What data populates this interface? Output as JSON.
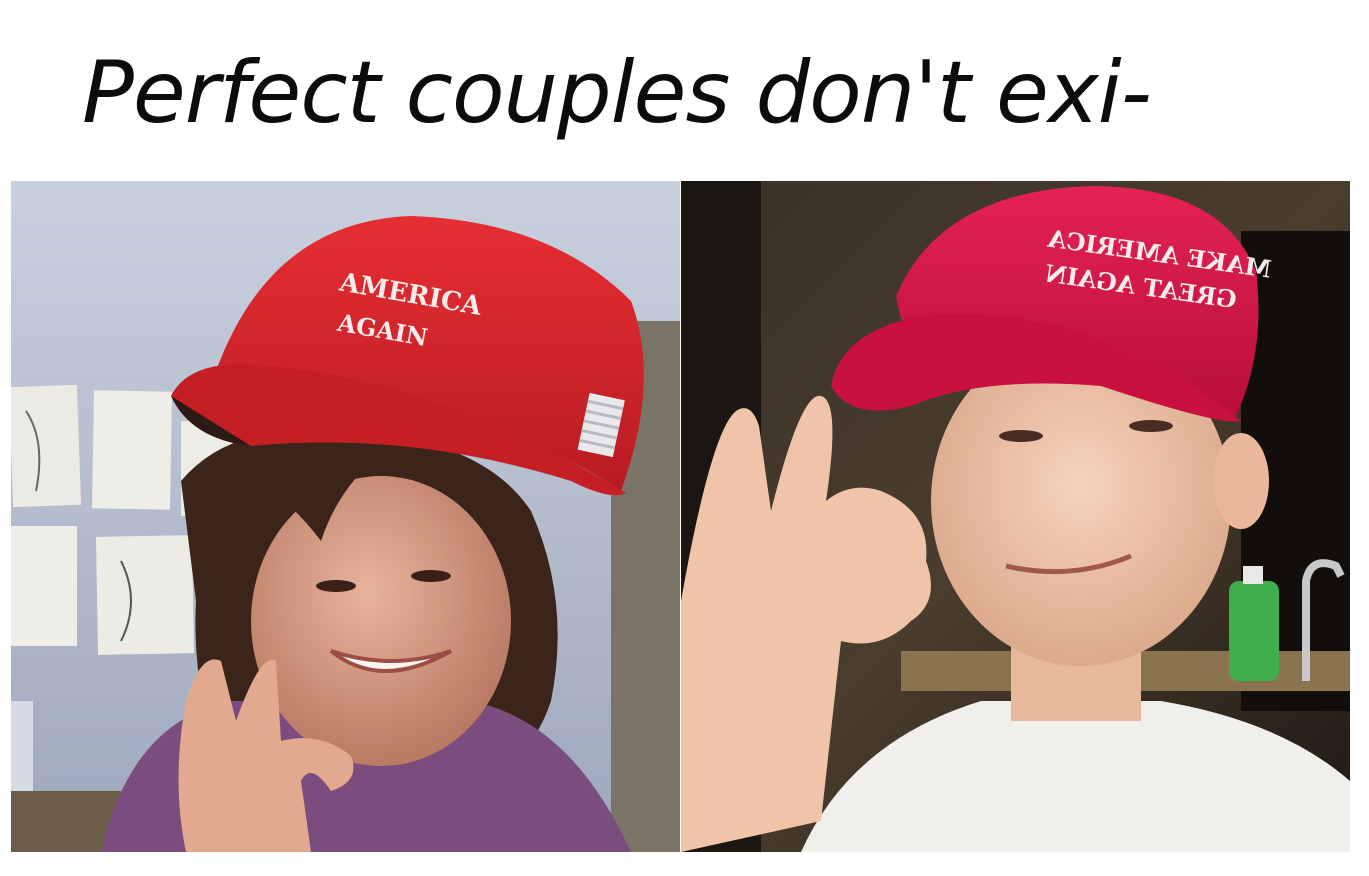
{
  "caption": {
    "text": "Perfect couples don't exi-"
  },
  "photos": {
    "left": {
      "hat": {
        "line1": "AMERICA",
        "line2": "AGAIN"
      }
    },
    "right": {
      "hat": {
        "line1": "MAKE AMERICA",
        "line2": "GREAT AGAIN"
      }
    }
  },
  "colors": {
    "background": "#ffffff",
    "caption": "#0c0c0c",
    "hat_left": "#d8232a",
    "hat_right": "#d81848",
    "wall_left": "#b9c3d6",
    "room_right": "#2a231c"
  }
}
